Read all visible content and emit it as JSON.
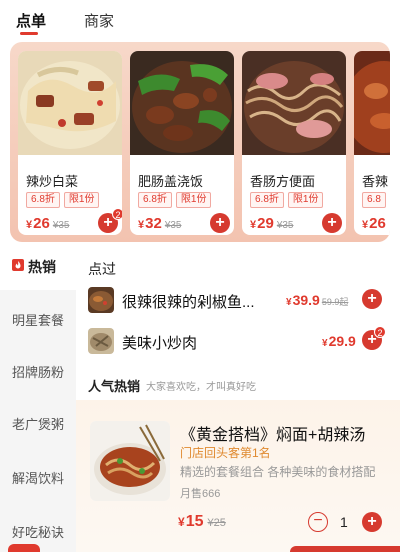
{
  "tabs": {
    "active": "点单",
    "inactive": "商家"
  },
  "featured": [
    {
      "name": "辣炒白菜",
      "discount": "6.8折",
      "limit": "限1份",
      "price": "26",
      "orig": "¥35",
      "badge": "2"
    },
    {
      "name": "肥肠盖浇饭",
      "discount": "6.8折",
      "limit": "限1份",
      "price": "32",
      "orig": "¥35",
      "badge": ""
    },
    {
      "name": "香肠方便面",
      "discount": "6.8折",
      "limit": "限1份",
      "price": "29",
      "orig": "¥35",
      "badge": ""
    },
    {
      "name": "香辣",
      "discount": "6.8",
      "limit": "",
      "price": "26",
      "orig": "",
      "badge": ""
    }
  ],
  "sidebar": {
    "hot_label": "热销",
    "items": [
      "明星套餐",
      "招牌肠粉",
      "老广煲粥",
      "解渴饮料",
      "好吃秘诀"
    ]
  },
  "recent": {
    "title": "点过",
    "items": [
      {
        "name": "很辣很辣的剁椒鱼...",
        "price": "39.9",
        "orig": "59.9起",
        "badge": ""
      },
      {
        "name": "美味小炒肉",
        "price": "29.9",
        "orig": "",
        "badge": "2"
      }
    ]
  },
  "popular": {
    "title": "人气热销",
    "subtitle": "大家喜欢吃，才叫真好吃",
    "combo": {
      "name": "《黄金搭档》焖面+胡辣汤",
      "rank": "门店回头客第1名",
      "desc": "精选的套餐组合 各种美味的食材搭配",
      "sales": "月售666",
      "price": "15",
      "orig": "¥25",
      "qty": "1"
    }
  },
  "symbols": {
    "yen": "¥",
    "plus": "+",
    "minus": "−"
  },
  "colors": {
    "accent": "#e03a2e",
    "button": "#d63a2f",
    "rank": "#e08a30"
  }
}
